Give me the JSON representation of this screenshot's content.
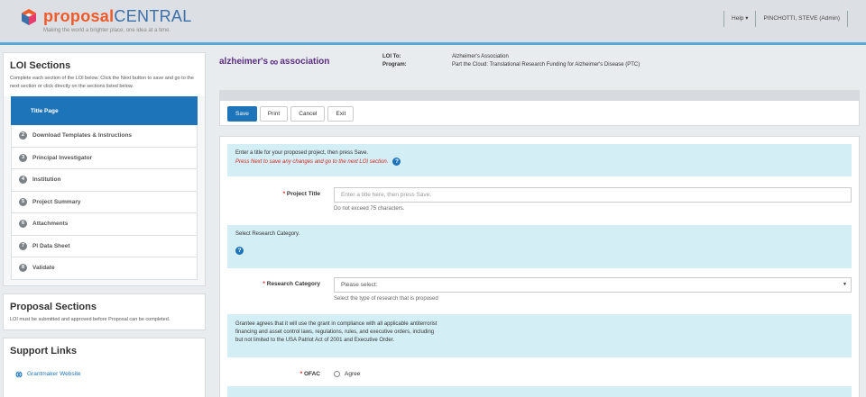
{
  "app": {
    "brand_bold": "proposal",
    "brand_thin": "CENTRAL",
    "tagline": "Making the world a brighter place, one idea at a time.",
    "help_label": "Help ▾",
    "user_label": "PINCHOTTI, STEVE (Admin)"
  },
  "sidebar": {
    "loi_title": "LOI Sections",
    "loi_desc": "Complete each section of the LOI below. Click the Next button to save and go to the next section or click directly on the sections listed below.",
    "steps": [
      {
        "num": "",
        "label": "Title Page"
      },
      {
        "num": "2",
        "label": "Download Templates & Instructions"
      },
      {
        "num": "3",
        "label": "Principal Investigator"
      },
      {
        "num": "4",
        "label": "Institution"
      },
      {
        "num": "5",
        "label": "Project Summary"
      },
      {
        "num": "6",
        "label": "Attachments"
      },
      {
        "num": "7",
        "label": "PI Data Sheet"
      },
      {
        "num": "8",
        "label": "Validate"
      }
    ],
    "proposal_title": "Proposal Sections",
    "proposal_desc": "LOI must be submitted and approved before Proposal can be completed.",
    "support_title": "Support Links",
    "support_link": "Grantmaker Website"
  },
  "org": {
    "logo_left": "alzheimer's",
    "logo_right": "association",
    "loi_to_label": "LOI To:",
    "loi_to_value": "Alzheimer's Association",
    "program_label": "Program:",
    "program_value": "Part the Cloud: Translational Research Funding for Alzheimer's Disease (PTC)"
  },
  "toolbar": {
    "save": "Save",
    "print": "Print",
    "cancel": "Cancel",
    "exit": "Exit"
  },
  "form": {
    "title_info": "Enter a title for your proposed project, then press Save.",
    "title_info_red": "Press Next to save any changes and go to the next LOI section.",
    "project_title_label": "Project Title",
    "project_title_placeholder": "Enter a title here, then press Save.",
    "project_title_hint": "Do not exceed 75 characters.",
    "category_info": "Select Research Category.",
    "category_label": "Research Category",
    "category_value": "Please select:",
    "category_hint": "Select the type of research that is proposed",
    "ofac_info_1": "Grantee agrees that it will use the grant in compliance with all applicable antiterrorist",
    "ofac_info_2": "financing and asset control laws, regulations, rules, and executive orders, including",
    "ofac_info_3": "but not limited to the USA Patriot Act of 2001 and Executive Order.",
    "ofac_label": "OFAC",
    "ofac_option": "Agree"
  },
  "colors": {
    "primary": "#1d74b8",
    "brand_orange": "#f05a28",
    "info_bg": "#d4eef5",
    "required_red": "#d9251c",
    "alz_purple": "#5b2c83"
  }
}
